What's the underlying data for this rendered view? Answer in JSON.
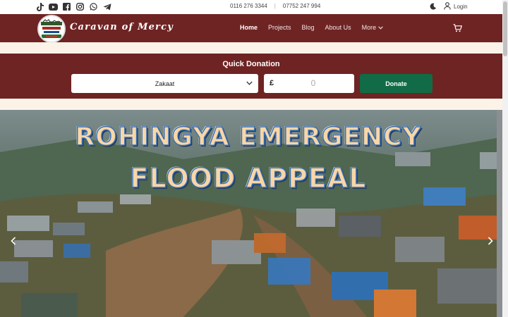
{
  "topbar": {
    "social_icons": [
      "tiktok-icon",
      "youtube-icon",
      "facebook-icon",
      "instagram-icon",
      "whatsapp-icon",
      "telegram-icon"
    ],
    "phone_1": "0116 276 3344",
    "separator": "|",
    "phone_2": "07752 247 994",
    "login_label": "Login"
  },
  "header": {
    "brand": "Caravan of Mercy",
    "nav": {
      "home": "Home",
      "projects": "Projects",
      "blog": "Blog",
      "about": "About Us",
      "more": "More"
    }
  },
  "quick_donation": {
    "title": "Quick Donation",
    "type_selected": "Zakaat",
    "currency": "£",
    "amount": "0",
    "donate_label": "Donate"
  },
  "hero": {
    "line_1": "ROHINGYA EMERGENCY",
    "line_2": "FLOOD APPEAL"
  },
  "colors": {
    "brand_maroon": "#6e2423",
    "donate_green": "#106b46",
    "cream": "#fbf3e8"
  }
}
